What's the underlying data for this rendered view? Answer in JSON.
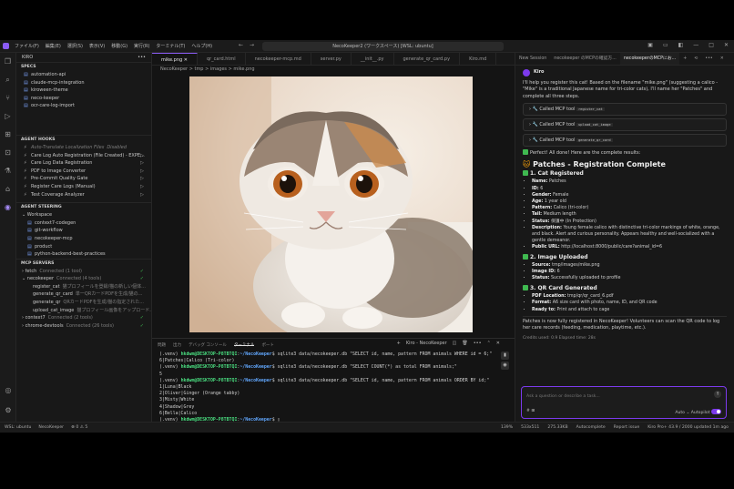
{
  "window": {
    "menu": [
      "ファイル(F)",
      "編集(E)",
      "選択(S)",
      "表示(V)",
      "移動(G)",
      "実行(R)",
      "ターミナル(T)",
      "ヘルプ(H)"
    ],
    "command_center": "NecoKeeper2 (ワークスペース) [WSL: ubuntu]"
  },
  "sidebar": {
    "title": "KIRO",
    "specs_title": "SPECS",
    "specs": [
      "automation-api",
      "claude-mcp-integration",
      "kiroween-theme",
      "neco-keeper",
      "ocr-care-log-import"
    ],
    "hooks_title": "AGENT HOOKS",
    "hooks": [
      {
        "label": "Auto-Translate Localization Files",
        "sub": "Disabled"
      },
      {
        "label": "Care Log Auto Registration (File Created) - EXPE...",
        "sub": ""
      },
      {
        "label": "Care Log Data Registration",
        "sub": ""
      },
      {
        "label": "PDF to Image Converter",
        "sub": ""
      },
      {
        "label": "Pre-Commit Quality Gate",
        "sub": ""
      },
      {
        "label": "Register Care Logs (Manual)",
        "sub": ""
      },
      {
        "label": "Test Coverage Analyzer",
        "sub": ""
      }
    ],
    "steering_title": "AGENT STEERING",
    "steering_group": "Workspace",
    "steering": [
      "context7-codegen",
      "git-workflow",
      "necokeeper-mcp",
      "product",
      "python-backend-best-practices"
    ],
    "mcp_title": "MCP SERVERS",
    "mcp": [
      {
        "label": "fetch",
        "sub": "Connected (1 tool)",
        "indent": false
      },
      {
        "label": "necokeeper",
        "sub": "Connected (4 tools)",
        "indent": false
      },
      {
        "label": "register_cat",
        "sub": "猫プロフィールを登録/猫の新しい個体...",
        "indent": true
      },
      {
        "label": "generate_qr_card",
        "sub": "単一QRカードPDFを生成/猫の...",
        "indent": true
      },
      {
        "label": "generate_qr",
        "sub": "QRカードPDFを生成/猫の指定された...",
        "indent": true
      },
      {
        "label": "upload_cat_image",
        "sub": "猫プロフィール画像をアップロード...",
        "indent": true
      },
      {
        "label": "context7",
        "sub": "Connected (2 tools)",
        "indent": false
      },
      {
        "label": "chrome-devtools",
        "sub": "Connected (26 tools)",
        "indent": false
      }
    ]
  },
  "editor": {
    "tabs": [
      "mike.png",
      "qr_card.html",
      "necokeeper-mcp.md",
      "server.py",
      "__init__.py",
      "generate_qr_card.py",
      "Kiro.md"
    ],
    "breadcrumb": "NecoKeeper  >  tmp  >  images  >  mike.png"
  },
  "panel": {
    "tabs": [
      "問題",
      "出力",
      "デバッグ コンソール",
      "ターミナル",
      "ポート"
    ],
    "terminal_name": "Kiro - NecoKeeper",
    "prompt_user": "hkdwm@DESKTOP-P8TBTQI",
    "prompt_path": "~/NecoKeeper",
    "lines": [
      {
        "cmd": "sqlite3 data/necokeeper.db \"SELECT id, name, pattern FROM animals WHERE id = 6;\"",
        "out": [
          "6|Patches|Calico (Tri-color)"
        ]
      },
      {
        "cmd": "sqlite3 data/necokeeper.db \"SELECT COUNT(*) as total FROM animals;\"",
        "out": [
          "5"
        ]
      },
      {
        "cmd": "sqlite3 data/necokeeper.db \"SELECT id, name, pattern FROM animals ORDER BY id;\"",
        "out": [
          "1|Luna|Black",
          "2|Oliver|Ginger (Orange tabby)",
          "3|Misty|White",
          "4|Shadow|Grey",
          "6|Bella|Calico"
        ]
      },
      {
        "cmd": "",
        "out": []
      }
    ]
  },
  "chat": {
    "tabs": [
      "New Session",
      "necokeeper のMCPの確認方...",
      "necokeeperのMCPにお..."
    ],
    "agent": "Kiro",
    "intro": "I'll help you register this cat! Based on the filename \"mike.png\" (suggesting a calico - \"Mike\" is a traditional Japanese name for tri-color cats), I'll name her \"Patches\" and complete all three steps.",
    "tools": [
      {
        "label": "Called MCP tool",
        "code": "register_cat"
      },
      {
        "label": "Called MCP tool",
        "code": "upload_cat_image"
      },
      {
        "label": "Called MCP tool",
        "code": "generate_qr_card"
      }
    ],
    "perfect": "Perfect! All done! Here are the complete results:",
    "title": "Patches - Registration Complete",
    "s1_title": "1. Cat Registered",
    "s1": [
      {
        "k": "Name:",
        "v": "Patches"
      },
      {
        "k": "ID:",
        "v": "6"
      },
      {
        "k": "Gender:",
        "v": "Female"
      },
      {
        "k": "Age:",
        "v": "1 year old"
      },
      {
        "k": "Pattern:",
        "v": "Calico (tri-color)"
      },
      {
        "k": "Tail:",
        "v": "Medium length"
      },
      {
        "k": "Status:",
        "v": "保護中 (In Protection)"
      },
      {
        "k": "Description:",
        "v": "Young female calico with distinctive tri-color markings of white, orange, and black. Alert and curious personality. Appears healthy and well-socialized with a gentle demeanor."
      },
      {
        "k": "Public URL:",
        "v": "http://localhost:8000/public/care?animal_id=6"
      }
    ],
    "s2_title": "2. Image Uploaded",
    "s2": [
      {
        "k": "Source:",
        "v": "tmp/images/mike.png"
      },
      {
        "k": "Image ID:",
        "v": "6"
      },
      {
        "k": "Status:",
        "v": "Successfully uploaded to profile"
      }
    ],
    "s3_title": "3. QR Card Generated",
    "s3": [
      {
        "k": "PDF Location:",
        "v": "tmp/qr/qr_card_6.pdf"
      },
      {
        "k": "Format:",
        "v": "A6 size card with photo, name, ID, and QR code"
      },
      {
        "k": "Ready to:",
        "v": "Print and attach to cage"
      }
    ],
    "final": "Patches is now fully registered in NecoKeeper! Volunteers can scan the QR code to log her care records (feeding, medication, playtime, etc.).",
    "credits": "Credits used: 0.9    Elapsed time: 28s",
    "input_placeholder": "Ask a question or describe a task...",
    "mode": "Auto",
    "autopilot": "Autopilot"
  },
  "status": {
    "left": [
      "WSL: ubuntu",
      "NecoKeeper",
      "⊗ 0 ⚠ 5"
    ],
    "right": [
      "139%",
      "533x511",
      "275.33KB",
      "Autocomplete",
      "Report issue",
      "Kiro Pro+ 43.9 / 2000 updated 1m ago"
    ]
  },
  "colors": {
    "accent": "#8b5cf6",
    "ok": "#3fb950"
  }
}
